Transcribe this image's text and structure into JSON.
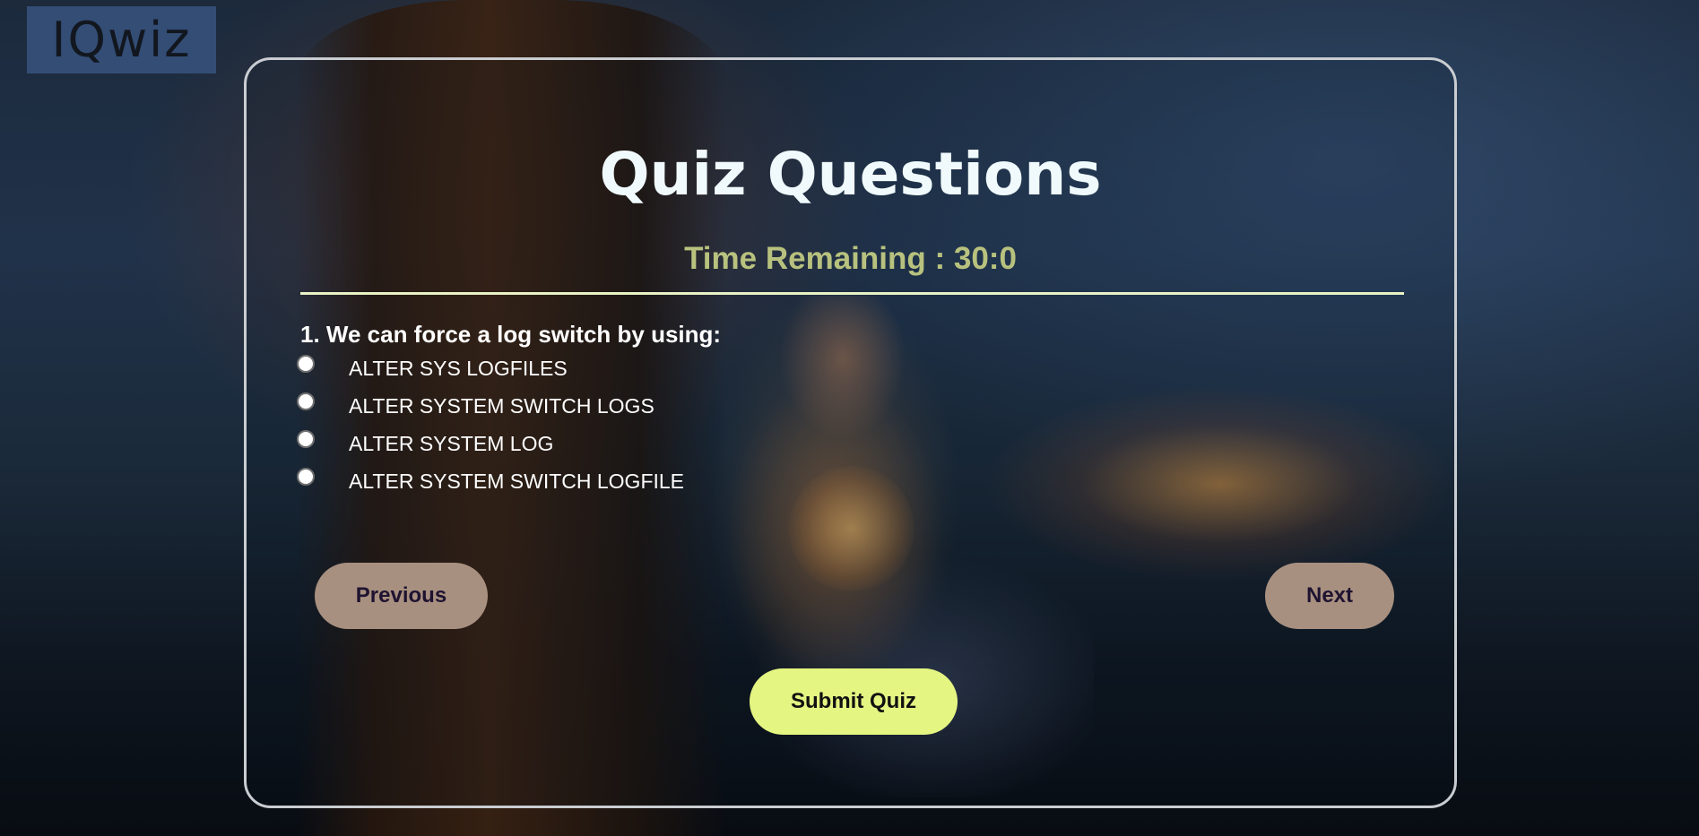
{
  "logo": {
    "text": "IQwiz"
  },
  "quiz": {
    "title": "Quiz Questions",
    "timer": "Time Remaining : 30:0",
    "question": "1. We can force a log switch by using:",
    "options": [
      {
        "label": "ALTER SYS LOGFILES"
      },
      {
        "label": "ALTER SYSTEM SWITCH LOGS"
      },
      {
        "label": "ALTER SYSTEM LOG"
      },
      {
        "label": "ALTER SYSTEM SWITCH LOGFILE"
      }
    ]
  },
  "buttons": {
    "previous": "Previous",
    "next": "Next",
    "submit": "Submit Quiz"
  },
  "colors": {
    "timer": "#b8c27e",
    "divider": "#e9f3c6",
    "nav_button": "#a89080",
    "submit_button": "#e4f582",
    "card_border": "#c9cdd1"
  }
}
